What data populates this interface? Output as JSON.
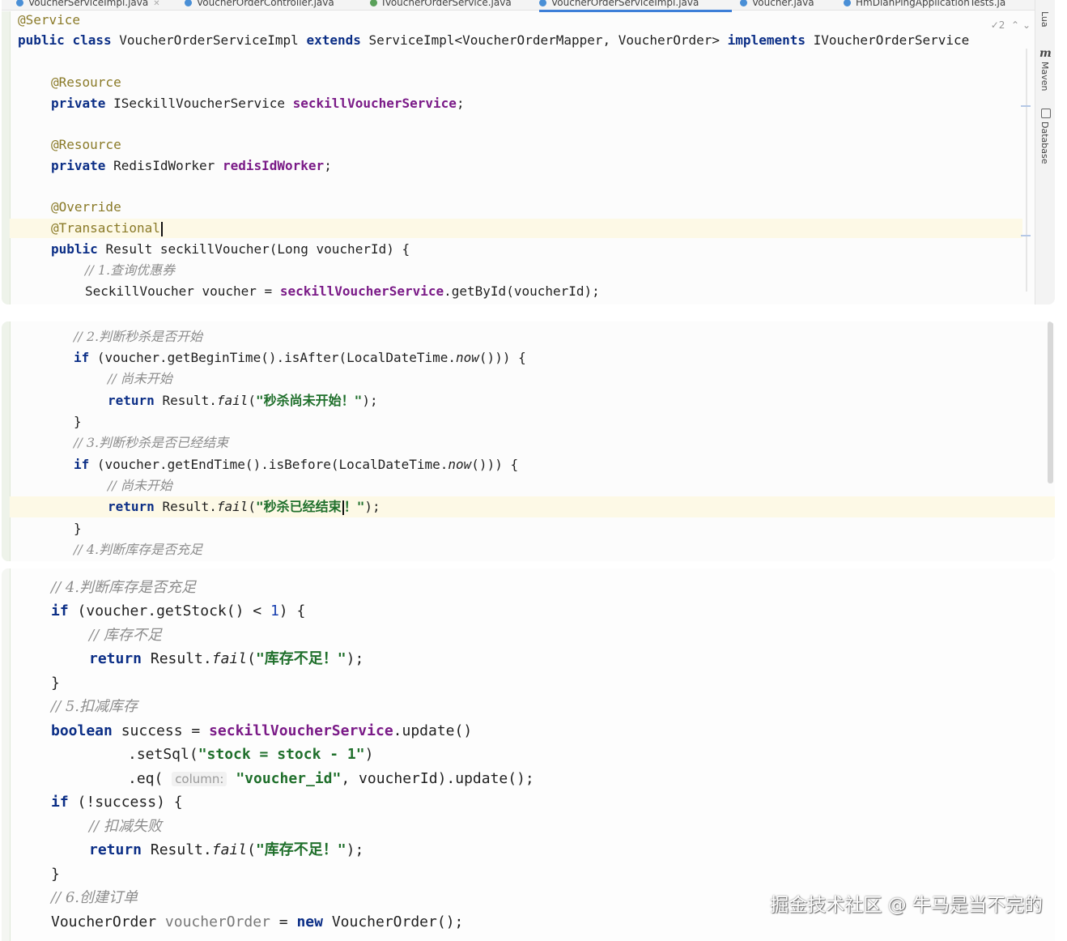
{
  "tabs": [
    {
      "label": "VoucherServiceImpl.java",
      "active": false
    },
    {
      "label": "VoucherOrderController.java",
      "active": false
    },
    {
      "label": "IVoucherOrderService.java",
      "active": false
    },
    {
      "label": "VoucherOrderServiceImpl.java",
      "active": true
    },
    {
      "label": "Voucher.java",
      "active": false
    },
    {
      "label": "HmDianPingApplicationTests.ja",
      "active": false
    }
  ],
  "editor": {
    "inspection_count": "2",
    "up_arrow": "⌃",
    "down_arrow": "⌄"
  },
  "sidebar": {
    "lua": "Lua",
    "maven_m": "m",
    "maven": "Maven",
    "database": "Database"
  },
  "code": {
    "service_ann": "@Service",
    "kw_public": "public",
    "kw_class": "class",
    "class_name": "VoucherOrderServiceImpl",
    "kw_extends": "extends",
    "super_type": "ServiceImpl<VoucherOrderMapper, VoucherOrder>",
    "kw_implements": "implements",
    "iface": "IVoucherOrderService",
    "resource_ann": "@Resource",
    "kw_private": "private",
    "type_seckill_service": "ISeckillVoucherService",
    "field_seckill_service": "seckillVoucherService",
    "semicolon": ";",
    "type_redis": "RedisIdWorker",
    "field_redis": "redisIdWorker",
    "override_ann": "@Override",
    "transactional_ann": "@Transactional",
    "method_sig": "Result seckillVoucher(Long voucherId) {",
    "c1": "// 1.查询优惠券",
    "voucher_decl": "SeckillVoucher voucher = ",
    "get_by_id": ".getById(voucherId);",
    "c2": "// 2.判断秒杀是否开始",
    "kw_if": "if",
    "cond_begin_a": "(voucher.getBeginTime().isAfter(LocalDateTime.",
    "now": "now",
    "cond_end_paren": "())) {",
    "c_not_started": "// 尚未开始",
    "kw_return": "return",
    "result_dot": "Result.",
    "fail": "fail",
    "paren_open": "(",
    "msg_not_started": "\"秒杀尚未开始！\"",
    "paren_close_semi": ");",
    "brace_close": "}",
    "c3": "// 3.判断秒杀是否已经结束",
    "cond_end_a": "(voucher.getEndTime().isBefore(LocalDateTime.",
    "msg_ended_a": "\"秒杀已经结束",
    "msg_ended_b": "！\"",
    "c4": "// 4.判断库存是否充足",
    "cond_stock_a": "(voucher.getStock() < ",
    "num_one": "1",
    "cond_stock_b": ") {",
    "c_stock_short": "// 库存不足",
    "msg_stock_short": "\"库存不足！\"",
    "c5": "// 5.扣减库存",
    "kw_boolean": "boolean",
    "success_assign": "success = ",
    "update_call": ".update()",
    "set_sql": ".setSql(",
    "sql_str": "\"stock = stock - 1\"",
    "close_paren": ")",
    "eq_open": ".eq( ",
    "hint_column": "column:",
    "str_voucher_id": "\"voucher_id\"",
    "eq_rest": ", voucherId).update();",
    "cond_not_success": "(!success) {",
    "c_deduct_fail": "// 扣减失败",
    "c6": "// 6.创建订单",
    "order_type": "VoucherOrder",
    "order_var": "voucherOrder",
    "assign": " = ",
    "kw_new": "new",
    "order_ctor": "VoucherOrder();"
  },
  "watermark": "掘金技术社区 @ 牛马是当不完的"
}
